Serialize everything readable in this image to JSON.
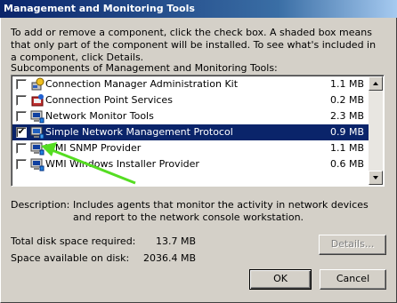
{
  "window": {
    "title": "Management and Monitoring Tools"
  },
  "intro_text": "To add or remove a component, click the check box. A shaded box means that only part of the component will be installed. To see what's included in a component, click Details.",
  "subcomponents_label": "Subcomponents of Management and Monitoring Tools:",
  "components": [
    {
      "name": "Connection Manager Administration Kit",
      "size": "1.1 MB",
      "checked": false,
      "icon": "connection-manager-icon"
    },
    {
      "name": "Connection Point Services",
      "size": "0.2 MB",
      "checked": false,
      "icon": "connection-point-icon"
    },
    {
      "name": "Network Monitor Tools",
      "size": "2.3 MB",
      "checked": false,
      "icon": "network-monitor-icon"
    },
    {
      "name": "Simple Network Management Protocol",
      "size": "0.9 MB",
      "checked": true,
      "selected": true,
      "icon": "snmp-icon"
    },
    {
      "name": "WMI SNMP Provider",
      "size": "1.1 MB",
      "checked": false,
      "icon": "wmi-snmp-icon"
    },
    {
      "name": "WMI Windows Installer Provider",
      "size": "0.6 MB",
      "checked": false,
      "icon": "wmi-installer-icon"
    }
  ],
  "description": {
    "label": "Description:",
    "text": "Includes agents that monitor the activity in network devices and report to the network console workstation."
  },
  "disk": {
    "required_label": "Total disk space required:",
    "required_value": "13.7 MB",
    "available_label": "Space available on disk:",
    "available_value": "2036.4 MB"
  },
  "buttons": {
    "details": "Details...",
    "ok": "OK",
    "cancel": "Cancel"
  },
  "colors": {
    "selection": "#0a246a",
    "annotation_arrow": "#55dd22"
  }
}
